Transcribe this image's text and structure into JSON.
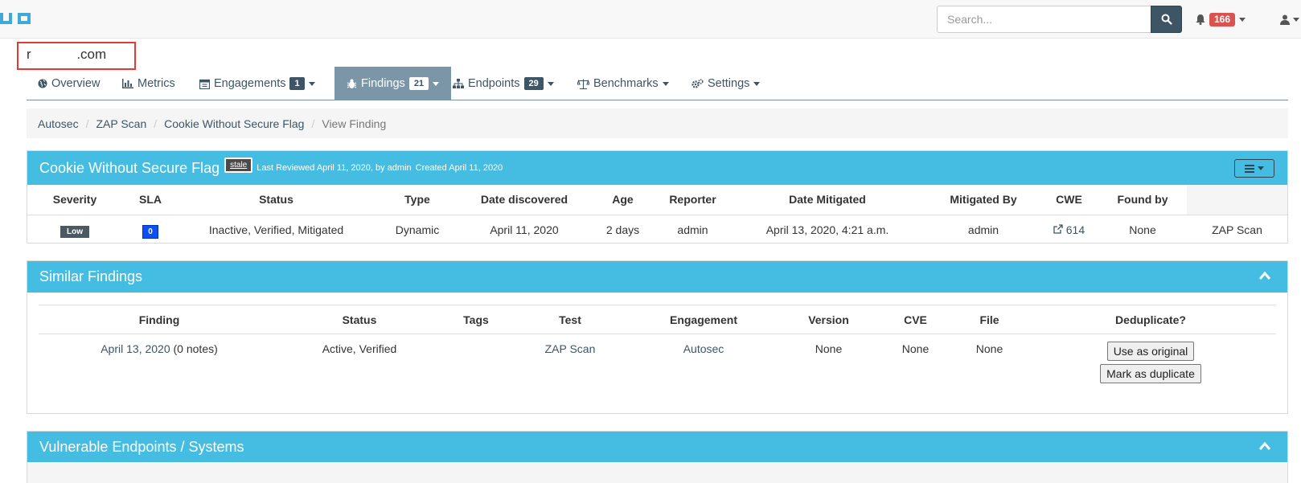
{
  "header": {
    "search_placeholder": "Search...",
    "notification_count": "166"
  },
  "product": {
    "name": "r            .com"
  },
  "tabs": [
    {
      "label": "Overview"
    },
    {
      "label": "Metrics"
    },
    {
      "label": "Engagements",
      "count": "1"
    },
    {
      "label": "Findings",
      "count": "21"
    },
    {
      "label": "Endpoints",
      "count": "29"
    },
    {
      "label": "Benchmarks"
    },
    {
      "label": "Settings"
    }
  ],
  "breadcrumb": [
    "Autosec",
    "ZAP Scan",
    "Cookie Without Secure Flag",
    "View Finding"
  ],
  "finding": {
    "title": "Cookie Without Secure Flag",
    "stale_label": "stale",
    "last_reviewed": "Last Reviewed April 11, 2020, by admin",
    "created": "Created April 11, 2020",
    "headers": [
      "Severity",
      "SLA",
      "Status",
      "Type",
      "Date discovered",
      "Age",
      "Reporter",
      "Date Mitigated",
      "Mitigated By",
      "CWE",
      "Found by"
    ],
    "severity": "Low",
    "sla": "0",
    "status": "Inactive, Verified, Mitigated",
    "type": "Dynamic",
    "date_discovered": "April 11, 2020",
    "age": "2 days",
    "reporter": "admin",
    "date_mitigated": "April 13, 2020, 4:21 a.m.",
    "mitigated_by": "admin",
    "cwe": "614",
    "found_by": "None",
    "test": "ZAP Scan"
  },
  "similar": {
    "title": "Similar Findings",
    "headers": [
      "Finding",
      "Status",
      "Tags",
      "Test",
      "Engagement",
      "Version",
      "CVE",
      "File",
      "Deduplicate?"
    ],
    "row": {
      "finding_link": "April 13, 2020",
      "finding_notes": " (0 notes)",
      "status": "Active, Verified",
      "tags": "",
      "test": "ZAP Scan",
      "engagement": "Autosec",
      "version": "None",
      "cve": "None",
      "file": "None",
      "use_original": "Use as original",
      "mark_duplicate": "Mark as duplicate"
    }
  },
  "endpoints": {
    "title": "Vulnerable Endpoints / Systems"
  },
  "colors": {
    "panel": "#45bde2",
    "nav_dark": "#3e5565",
    "active_tab": "#7b96a7",
    "danger": "#d9534f",
    "sla_blue": "#0d4ff2"
  }
}
